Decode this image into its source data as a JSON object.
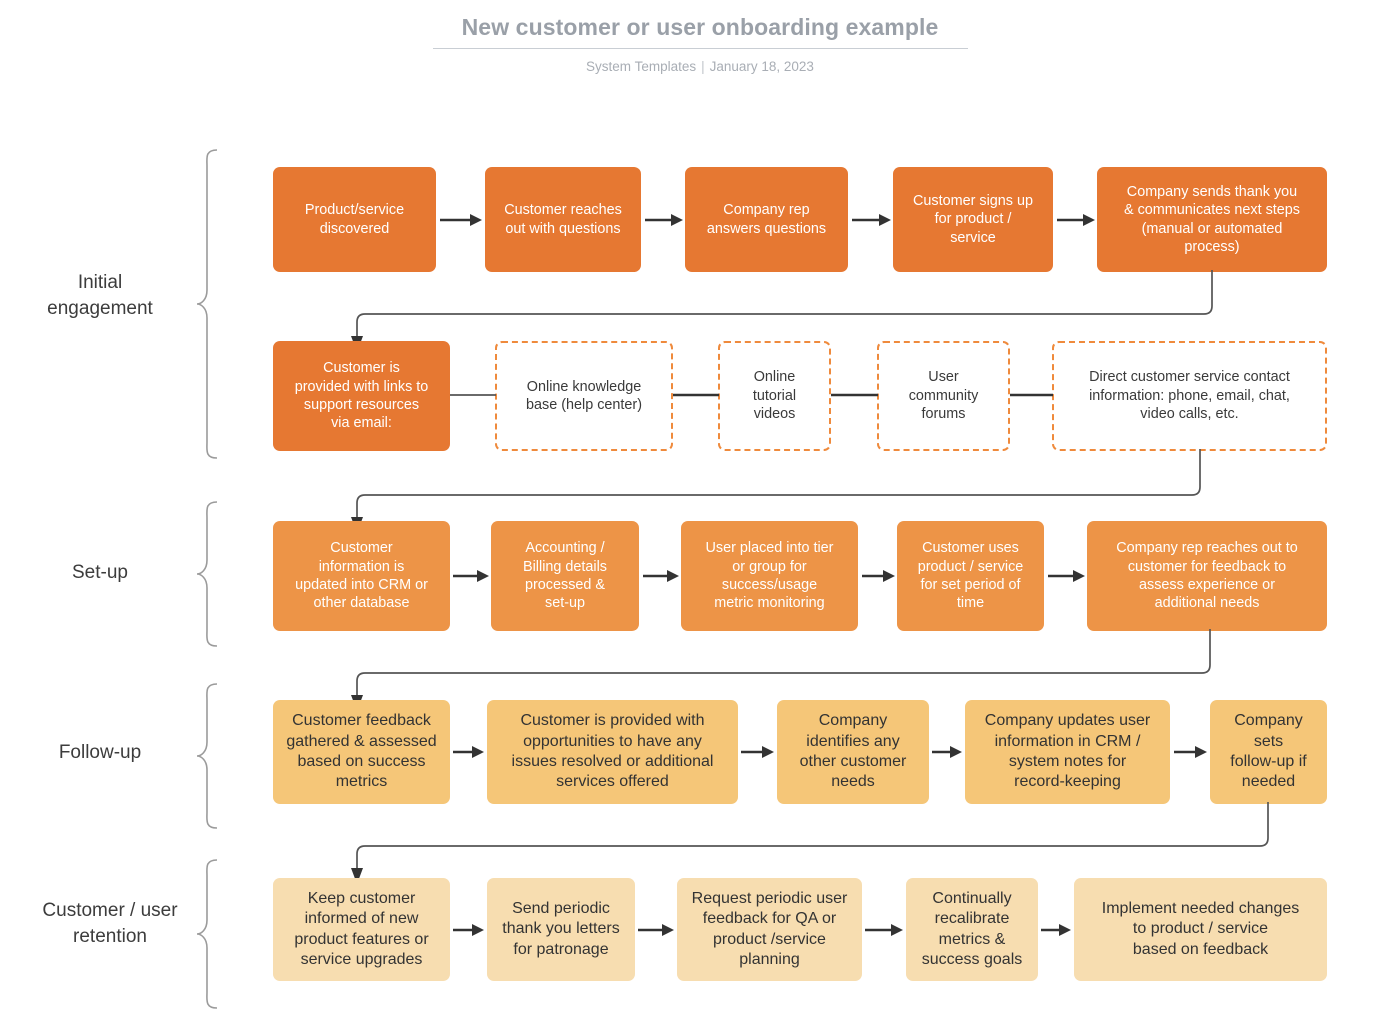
{
  "header": {
    "title": "New customer or user onboarding example",
    "source": "System Templates",
    "separator": "|",
    "date": "January 18, 2023"
  },
  "colors": {
    "tier1": "#e67832",
    "tier2": "#ed9447",
    "tier3": "#f5c678",
    "tier4": "#f7ddb0",
    "dashed_border": "#ef8a3c",
    "connector": "#4a4a4a",
    "brace": "#9b9b9b",
    "title": "#9aa0a8",
    "subtitle": "#a9aeb5"
  },
  "stages": [
    {
      "label": "Initial\nengagement"
    },
    {
      "label": "Set-up"
    },
    {
      "label": "Follow-up"
    },
    {
      "label": "Customer / user\nretention"
    }
  ],
  "chart_data": {
    "type": "diagram",
    "title": "New customer or user onboarding example",
    "subtitle": "System Templates | January 18, 2023",
    "diagram_kind": "flowchart",
    "rows": [
      {
        "stage": "Initial engagement",
        "style": "solid-dark-orange",
        "nodes": [
          "Product/service\ndiscovered",
          "Customer reaches\nout with questions",
          "Company rep\nanswers questions",
          "Customer signs up\nfor product /\nservice",
          "Company sends thank you\n& communicates next steps\n(manual or automated\nprocess)"
        ]
      },
      {
        "stage": "Initial engagement",
        "style": "mixed-solid-and-dashed",
        "nodes": [
          "Customer is\nprovided with links to\nsupport resources\nvia email:",
          "Online knowledge\nbase (help center)",
          "Online\ntutorial\nvideos",
          "User\ncommunity\nforums",
          "Direct customer service contact\ninformation: phone, email, chat,\nvideo calls, etc."
        ]
      },
      {
        "stage": "Set-up",
        "style": "solid-mid-orange",
        "nodes": [
          "Customer\ninformation is\nupdated into CRM or\nother database",
          "Accounting /\nBilling details\nprocessed &\nset-up",
          "User placed into tier\nor group for\nsuccess/usage\nmetric monitoring",
          "Customer uses\nproduct / service\nfor set period of\ntime",
          "Company rep reaches out to\ncustomer for feedback to\nassess experience or\nadditional needs"
        ]
      },
      {
        "stage": "Follow-up",
        "style": "solid-light-orange",
        "nodes": [
          "Customer feedback\ngathered & assessed\nbased on success\nmetrics",
          "Customer is provided with\nopportunities to have any\nissues resolved or additional\nservices offered",
          "Company\nidentifies any\nother customer\nneeds",
          "Company updates user\ninformation in CRM /\nsystem notes for\nrecord-keeping",
          "Company\nsets\nfollow-up if\nneeded"
        ]
      },
      {
        "stage": "Customer / user retention",
        "style": "solid-pale-orange",
        "nodes": [
          "Keep customer\ninformed of new\nproduct features or\nservice upgrades",
          "Send periodic\nthank you letters\nfor patronage",
          "Request periodic user\nfeedback for QA or\nproduct /service\nplanning",
          "Continually\nrecalibrate\nmetrics &\nsuccess goals",
          "Implement needed changes\nto product / service\nbased on feedback"
        ]
      }
    ],
    "flow": "left-to-right within each row, then an elbow connector from the last node of a row down and left into the first node of the next row",
    "legend": []
  }
}
